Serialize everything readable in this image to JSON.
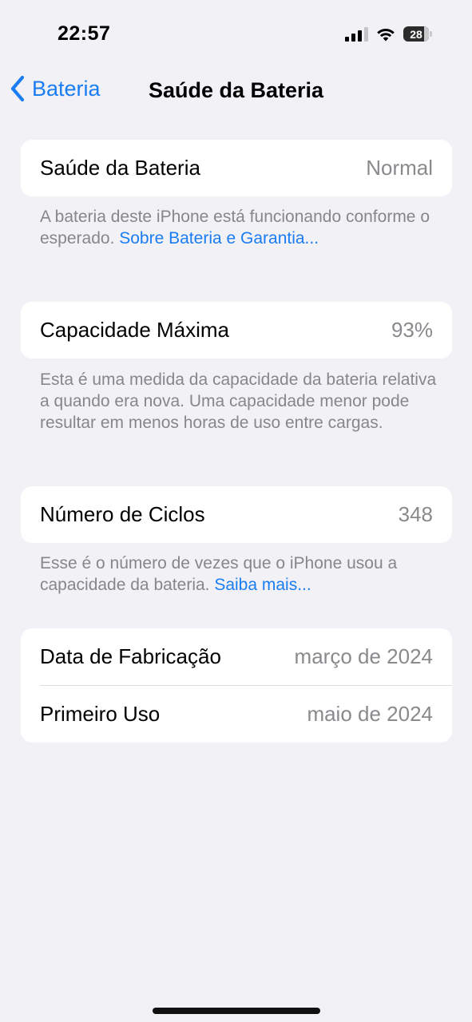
{
  "status_bar": {
    "time": "22:57",
    "battery_level": "28",
    "icons": [
      "cellular-signal-icon",
      "wifi-icon",
      "battery-icon"
    ]
  },
  "nav": {
    "back_label": "Bateria",
    "title": "Saúde da Bateria"
  },
  "battery_health": {
    "label": "Saúde da Bateria",
    "value": "Normal",
    "footnote_text": "A bateria deste iPhone está funcionando conforme o esperado. ",
    "footnote_link": "Sobre Bateria e Garantia..."
  },
  "max_capacity": {
    "label": "Capacidade Máxima",
    "value": "93%",
    "footnote_text": "Esta é uma medida da capacidade da bateria relativa a quando era nova. Uma capacidade menor pode resultar em menos horas de uso entre cargas."
  },
  "cycle_count": {
    "label": "Número de Ciclos",
    "value": "348",
    "footnote_text": "Esse é o número de vezes que o iPhone usou a capacidade da bateria. ",
    "footnote_link": "Saiba mais..."
  },
  "dates": {
    "manufacture_label": "Data de Fabricação",
    "manufacture_value": "março de 2024",
    "first_use_label": "Primeiro Uso",
    "first_use_value": "maio de 2024"
  },
  "colors": {
    "accent": "#1a7df2",
    "background": "#f1f1f6",
    "secondary_text": "#8a8a8e"
  }
}
